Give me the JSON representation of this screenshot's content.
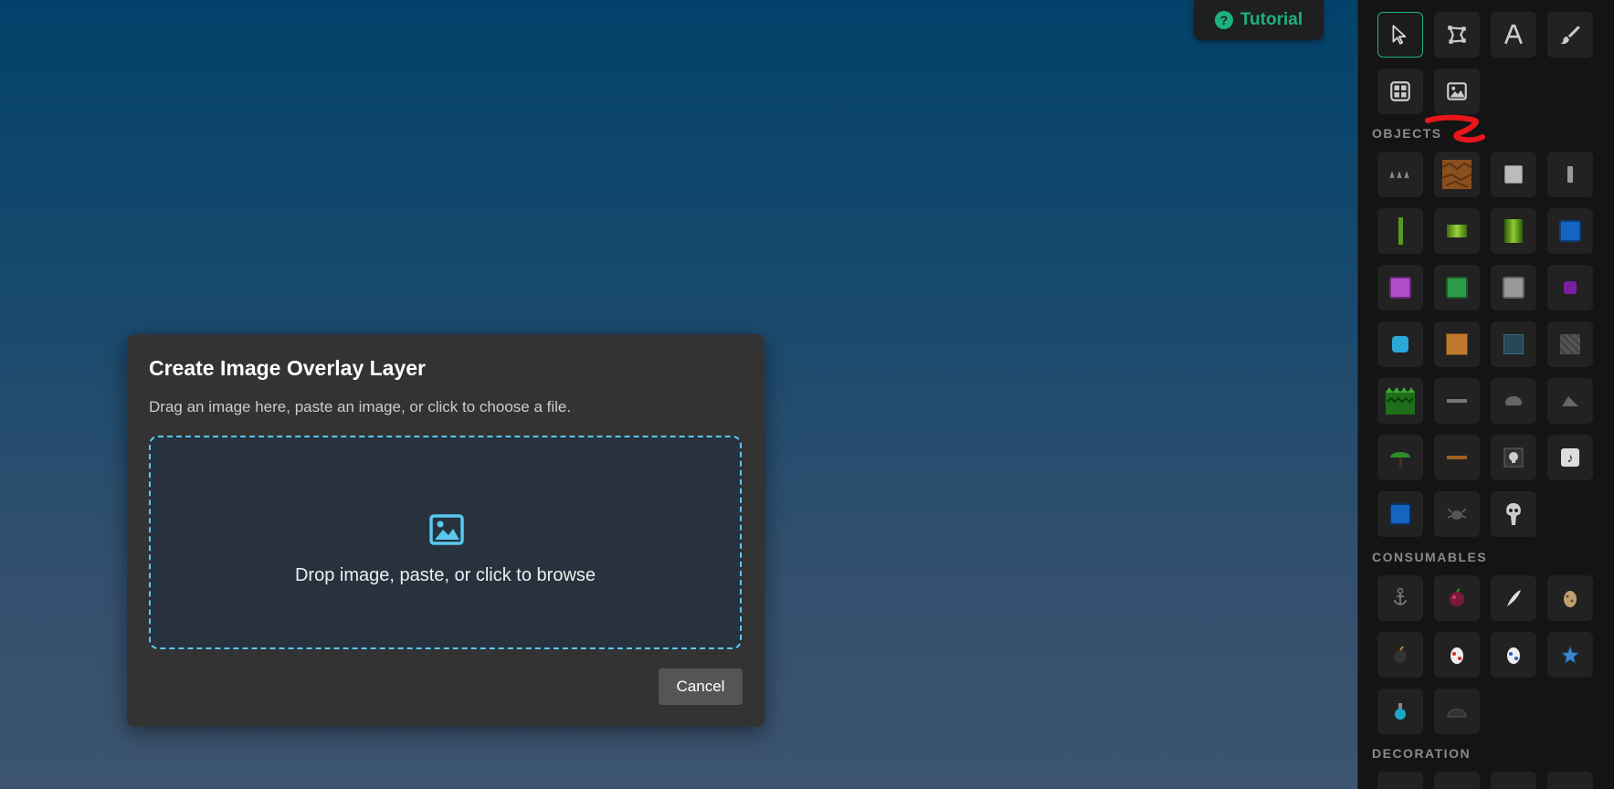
{
  "tutorial": {
    "label": "Tutorial",
    "icon": "question-circle-icon",
    "accent": "#1fb07f"
  },
  "tools": [
    {
      "name": "select-tool",
      "icon": "pointer-icon",
      "selected": true
    },
    {
      "name": "shape-tool",
      "icon": "vector-shape-icon",
      "selected": false
    },
    {
      "name": "text-tool",
      "icon": "text-a-icon",
      "selected": false
    },
    {
      "name": "brush-tool",
      "icon": "brush-icon",
      "selected": false
    },
    {
      "name": "grid-tool",
      "icon": "grid-icon",
      "selected": false
    },
    {
      "name": "image-overlay-tool",
      "icon": "image-icon",
      "selected": false
    }
  ],
  "sections": {
    "objects": "OBJECTS",
    "consumables": "CONSUMABLES",
    "decoration": "DECORATION"
  },
  "modal": {
    "title": "Create Image Overlay Layer",
    "description": "Drag an image here, paste an image, or click to choose a file.",
    "dropzone_text": "Drop image, paste, or click to browse",
    "cancel_label": "Cancel",
    "accent": "#5bc8f0"
  }
}
